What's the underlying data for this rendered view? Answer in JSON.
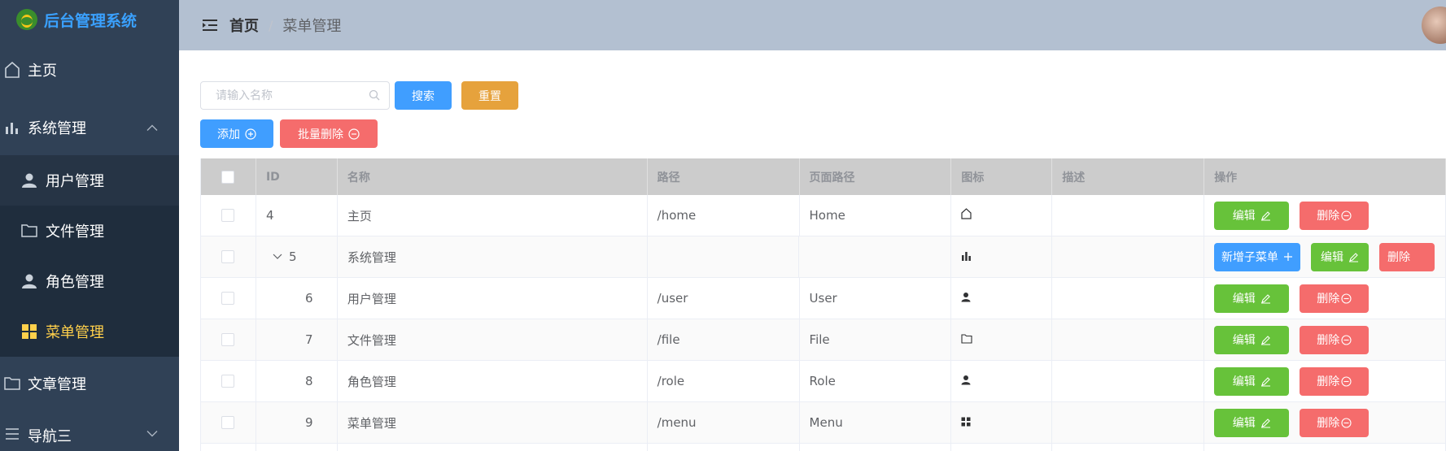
{
  "app": {
    "title": "后台管理系统"
  },
  "sidebar": {
    "items": [
      {
        "label": "主页",
        "icon": "house-icon"
      },
      {
        "label": "系统管理",
        "icon": "bar-chart-icon"
      },
      {
        "label": "文章管理",
        "icon": "folder-icon"
      },
      {
        "label": "导航三",
        "icon": "menu-icon"
      }
    ],
    "submenu": [
      {
        "label": "用户管理",
        "icon": "user-icon"
      },
      {
        "label": "文件管理",
        "icon": "folder-icon"
      },
      {
        "label": "角色管理",
        "icon": "user-icon"
      },
      {
        "label": "菜单管理",
        "icon": "grid-icon"
      }
    ]
  },
  "header": {
    "breadcrumb_home": "首页",
    "breadcrumb_sep": "/",
    "breadcrumb_current": "菜单管理"
  },
  "search": {
    "placeholder": "请输入名称",
    "search_label": "搜索",
    "reset_label": "重置"
  },
  "actions": {
    "add_label": "添加",
    "batch_delete_label": "批量删除"
  },
  "table": {
    "columns": [
      "ID",
      "名称",
      "路径",
      "页面路径",
      "图标",
      "描述",
      "操作"
    ],
    "rows": [
      {
        "id": "4",
        "name": "主页",
        "path": "/home",
        "page_path": "Home",
        "icon": "house-icon",
        "desc": ""
      },
      {
        "id": "5",
        "name": "系统管理",
        "path": "",
        "page_path": "",
        "icon": "bar-chart-icon",
        "desc": ""
      },
      {
        "id": "6",
        "name": "用户管理",
        "path": "/user",
        "page_path": "User",
        "icon": "user-icon",
        "desc": ""
      },
      {
        "id": "7",
        "name": "文件管理",
        "path": "/file",
        "page_path": "File",
        "icon": "folder-icon",
        "desc": ""
      },
      {
        "id": "8",
        "name": "角色管理",
        "path": "/role",
        "page_path": "Role",
        "icon": "user-icon",
        "desc": ""
      },
      {
        "id": "9",
        "name": "菜单管理",
        "path": "/menu",
        "page_path": "Menu",
        "icon": "grid-icon",
        "desc": ""
      }
    ],
    "edit_label": "编辑",
    "delete_label": "删除",
    "add_child_label": "新增子菜单"
  },
  "colors": {
    "sidebar_bg": "#304156",
    "submenu_bg": "#1f2d3d",
    "header_bg": "#b3c0d1",
    "active": "#ffd04b",
    "primary": "#409eff",
    "success": "#67c23a",
    "warning": "#e6a23c",
    "danger": "#f56c6c"
  }
}
